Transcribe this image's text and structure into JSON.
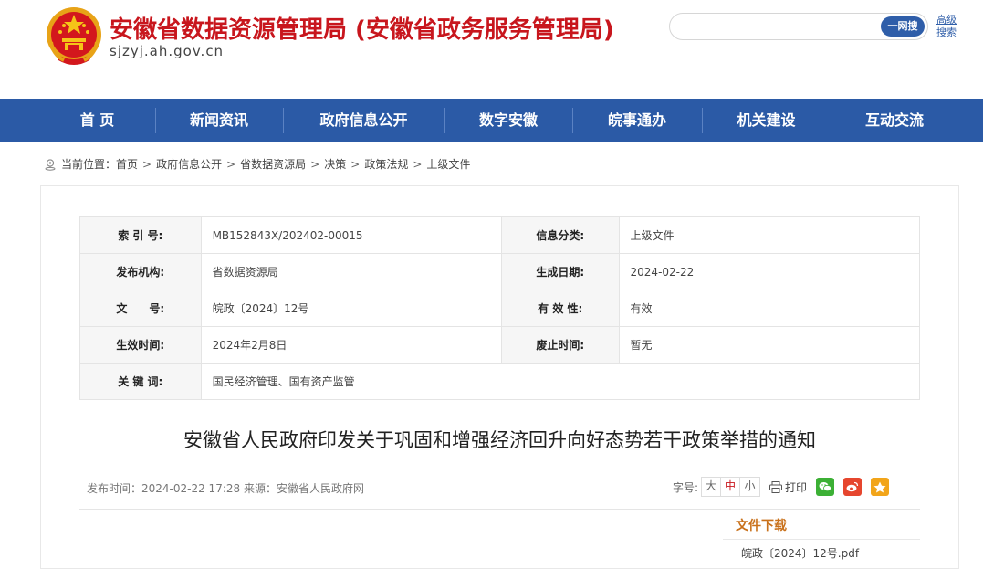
{
  "header": {
    "site_title": "安徽省数据资源管理局 (安徽省政务服务管理局)",
    "site_domain": "sjzyj.ah.gov.cn",
    "search": {
      "placeholder": "",
      "button_label": "一网搜",
      "advanced_label": "高级搜索"
    }
  },
  "nav": {
    "items": [
      "首 页",
      "新闻资讯",
      "政府信息公开",
      "数字安徽",
      "皖事通办",
      "机关建设",
      "互动交流"
    ]
  },
  "breadcrumb": {
    "prefix": "当前位置：",
    "items": [
      "首页",
      "政府信息公开",
      "省数据资源局",
      "决策",
      "政策法规",
      "上级文件"
    ],
    "separator": ">"
  },
  "meta": {
    "index_label": "索 引 号:",
    "index_value": "MB152843X/202402-00015",
    "category_label": "信息分类:",
    "category_value": "上级文件",
    "publisher_label": "发布机构:",
    "publisher_value": "省数据资源局",
    "date_label": "生成日期:",
    "date_value": "2024-02-22",
    "docno_label": "文　　号:",
    "docno_value": "皖政〔2024〕12号",
    "validity_label": "有 效 性:",
    "validity_value": "有效",
    "effective_label": "生效时间:",
    "effective_value": "2024年2月8日",
    "expiry_label": "废止时间:",
    "expiry_value": "暂无",
    "keywords_label": "关 键 词:",
    "keywords_value": "国民经济管理、国有资产监管"
  },
  "article": {
    "title": "安徽省人民政府印发关于巩固和增强经济回升向好态势若干政策举措的通知",
    "info": "发布时间：2024-02-22 17:28   来源：安徽省人民政府网",
    "font_size_label": "字号:",
    "font_sizes": [
      "大",
      "中",
      "小"
    ],
    "print_label": "打印"
  },
  "sidebar": {
    "download_title": "文件下载",
    "download_item": "皖政〔2024〕12号.pdf"
  },
  "colors": {
    "brand_red": "#c8161d",
    "nav_blue": "#2b5aa6",
    "download_orange": "#c9711b",
    "wechat_green": "#3cb035",
    "weibo_red": "#e6462e",
    "qzone_orange": "#f2a51a"
  },
  "icons": [
    "national-emblem-icon",
    "location-pin-icon",
    "printer-icon",
    "wechat-icon",
    "weibo-icon",
    "qzone-icon"
  ]
}
